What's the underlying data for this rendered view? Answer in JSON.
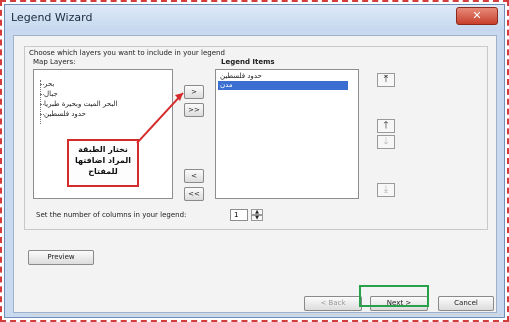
{
  "window": {
    "title": "Legend Wizard",
    "close_label": "✕"
  },
  "dialog": {
    "instruction": "Choose which layers you want to include in your legend",
    "map_layers_label": "Map Layers:",
    "legend_items_label": "Legend Items",
    "map_layers": [
      "بحر",
      "جبال",
      "البحر الميت وبحيرة طبريا",
      "حدود فلسطين"
    ],
    "legend_items": [
      {
        "label": "حدود فلسطين",
        "selected": false
      },
      {
        "label": "مدن",
        "selected": true
      }
    ],
    "buttons": {
      "add": ">",
      "add_all": ">>",
      "remove": "<",
      "remove_all": "<<",
      "preview": "Preview",
      "back": "< Back",
      "next": "Next >",
      "cancel": "Cancel"
    },
    "columns_label": "Set the number of columns in your legend:",
    "columns_value": "1",
    "annotation": "نختار الطبقة المراد اضافتها للمفتاح"
  },
  "colors": {
    "callout_border": "#d52b2b",
    "next_highlight": "#27a24b",
    "selection": "#3a6fd1"
  }
}
